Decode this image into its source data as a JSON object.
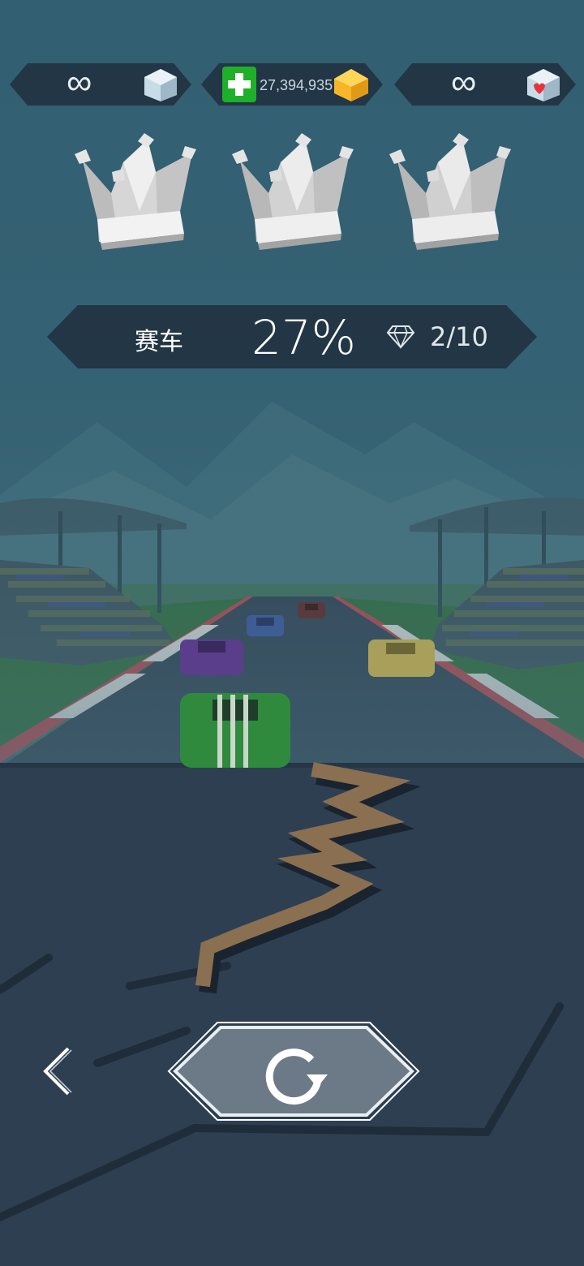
{
  "hud": {
    "left_counter": "∞",
    "left_icon": "ice-cube-icon",
    "coins": "27,394,935",
    "coin_add_icon": "green-plus-icon",
    "coin_icon": "gold-cube-icon",
    "right_counter": "∞",
    "right_icon": "heart-cube-icon"
  },
  "crowns": [
    {
      "icon": "silver-crown-icon"
    },
    {
      "icon": "silver-crown-icon"
    },
    {
      "icon": "silver-crown-icon"
    }
  ],
  "level": {
    "name": "赛车",
    "progress": "27%",
    "gems": "2/10",
    "gem_icon": "diamond-icon"
  },
  "controls": {
    "back_icon": "chevron-left-icon",
    "retry_icon": "restart-icon"
  },
  "colors": {
    "background": "#2f5a6d",
    "panel": "#223645",
    "road": "#2f3f52",
    "accent_green": "#1fb02a",
    "gold": "#f5b62a"
  }
}
